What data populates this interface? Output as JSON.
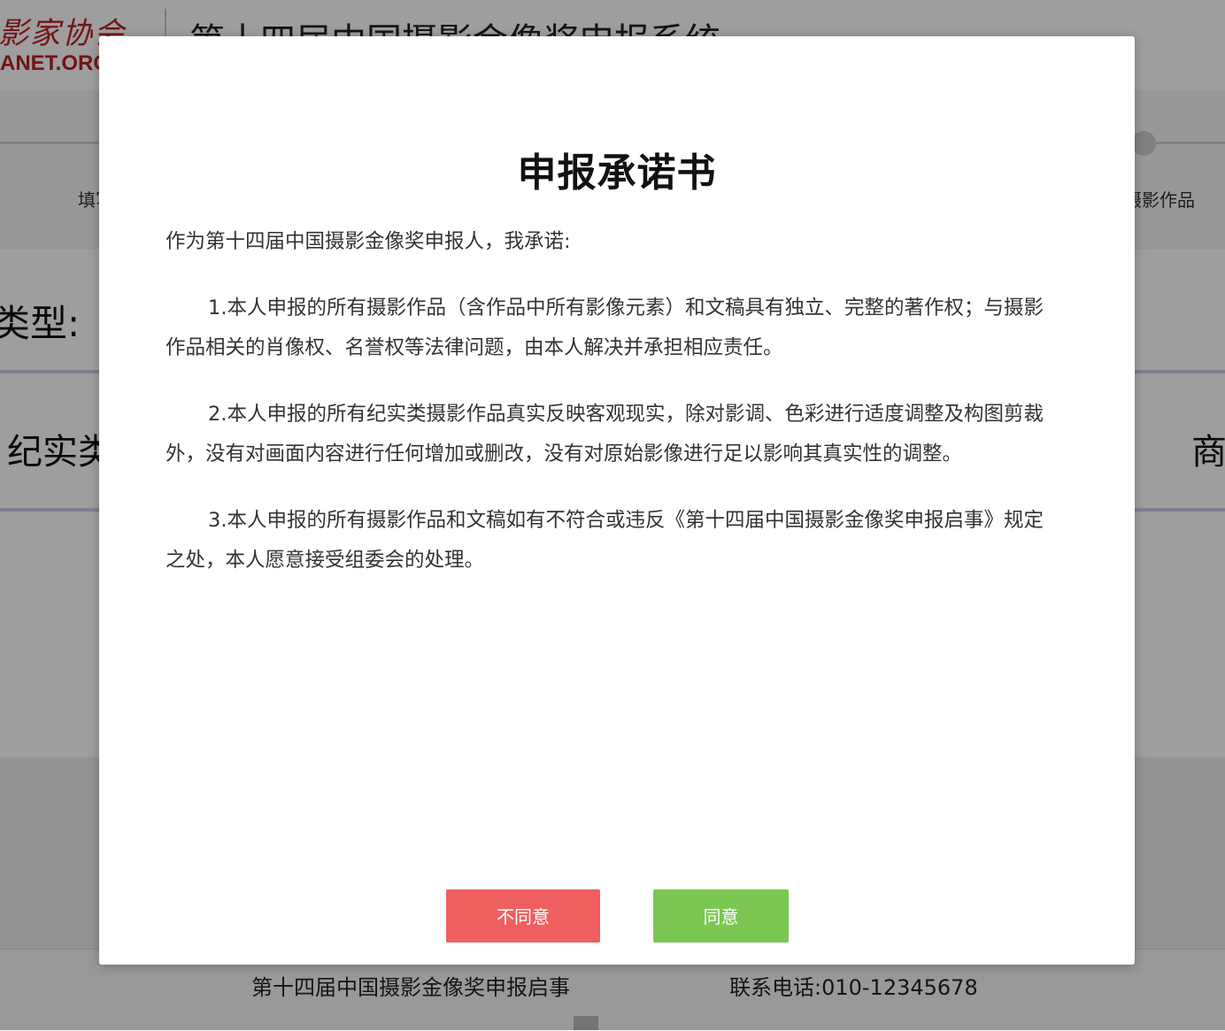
{
  "background": {
    "logo_script": "影家协会",
    "logo_text": "ANET.ORG",
    "header_title": "第十四届中国摄影金像奖申报系统",
    "step_left_label": "填写",
    "step_right_label": "摄影作品",
    "type_label": "类型:",
    "option_left": "纪实类",
    "option_right": "商",
    "footer_left": "第十四届中国摄影金像奖申报启事",
    "footer_right": "联系电话:010-12345678"
  },
  "modal": {
    "title": "申报承诺书",
    "intro": "作为第十四届中国摄影金像奖申报人，我承诺:",
    "clauses": [
      "1.本人申报的所有摄影作品（含作品中所有影像元素）和文稿具有独立、完整的著作权；与摄影作品相关的肖像权、名誉权等法律问题，由本人解决并承担相应责任。",
      "2.本人申报的所有纪实类摄影作品真实反映客观现实，除对影调、色彩进行适度调整及构图剪裁外，没有对画面内容进行任何增加或删改，没有对原始影像进行足以影响其真实性的调整。",
      "3.本人申报的所有摄影作品和文稿如有不符合或违反《第十四届中国摄影金像奖申报启事》规定之处，本人愿意接受组委会的处理。"
    ],
    "disagree_label": "不同意",
    "agree_label": "同意"
  },
  "colors": {
    "disagree": "#f05f5f",
    "agree": "#7cc752",
    "brand": "#b22222"
  }
}
